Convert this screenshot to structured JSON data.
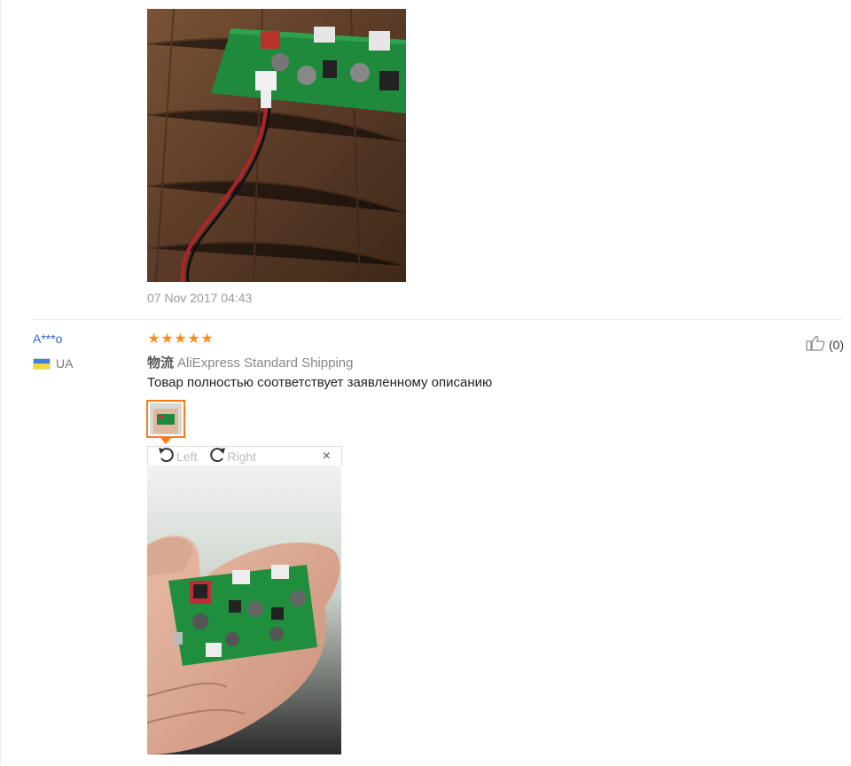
{
  "previous_review": {
    "photo_icon": "product-photo-pcb-on-wood",
    "date": "07 Nov 2017 04:43"
  },
  "review": {
    "user_name": "A***o",
    "country_code": "UA",
    "flag_colors": [
      "#3b7fd6",
      "#f5d538"
    ],
    "rating": 5,
    "stars": [
      "★",
      "★",
      "★",
      "★",
      "★"
    ],
    "shipping_label": "物流",
    "shipping_method": "AliExpress Standard Shipping",
    "text": "Товар полностью соответствует заявленному описанию",
    "helpful_count": "(0)",
    "viewer": {
      "rotate_left_label": "Left",
      "rotate_right_label": "Right",
      "close_label": "×"
    },
    "photo_icon": "product-photo-pcb-in-hand"
  },
  "colors": {
    "star": "#f78f1f",
    "user_link": "#3366cc",
    "thumb_border": "#ff7a1a"
  }
}
